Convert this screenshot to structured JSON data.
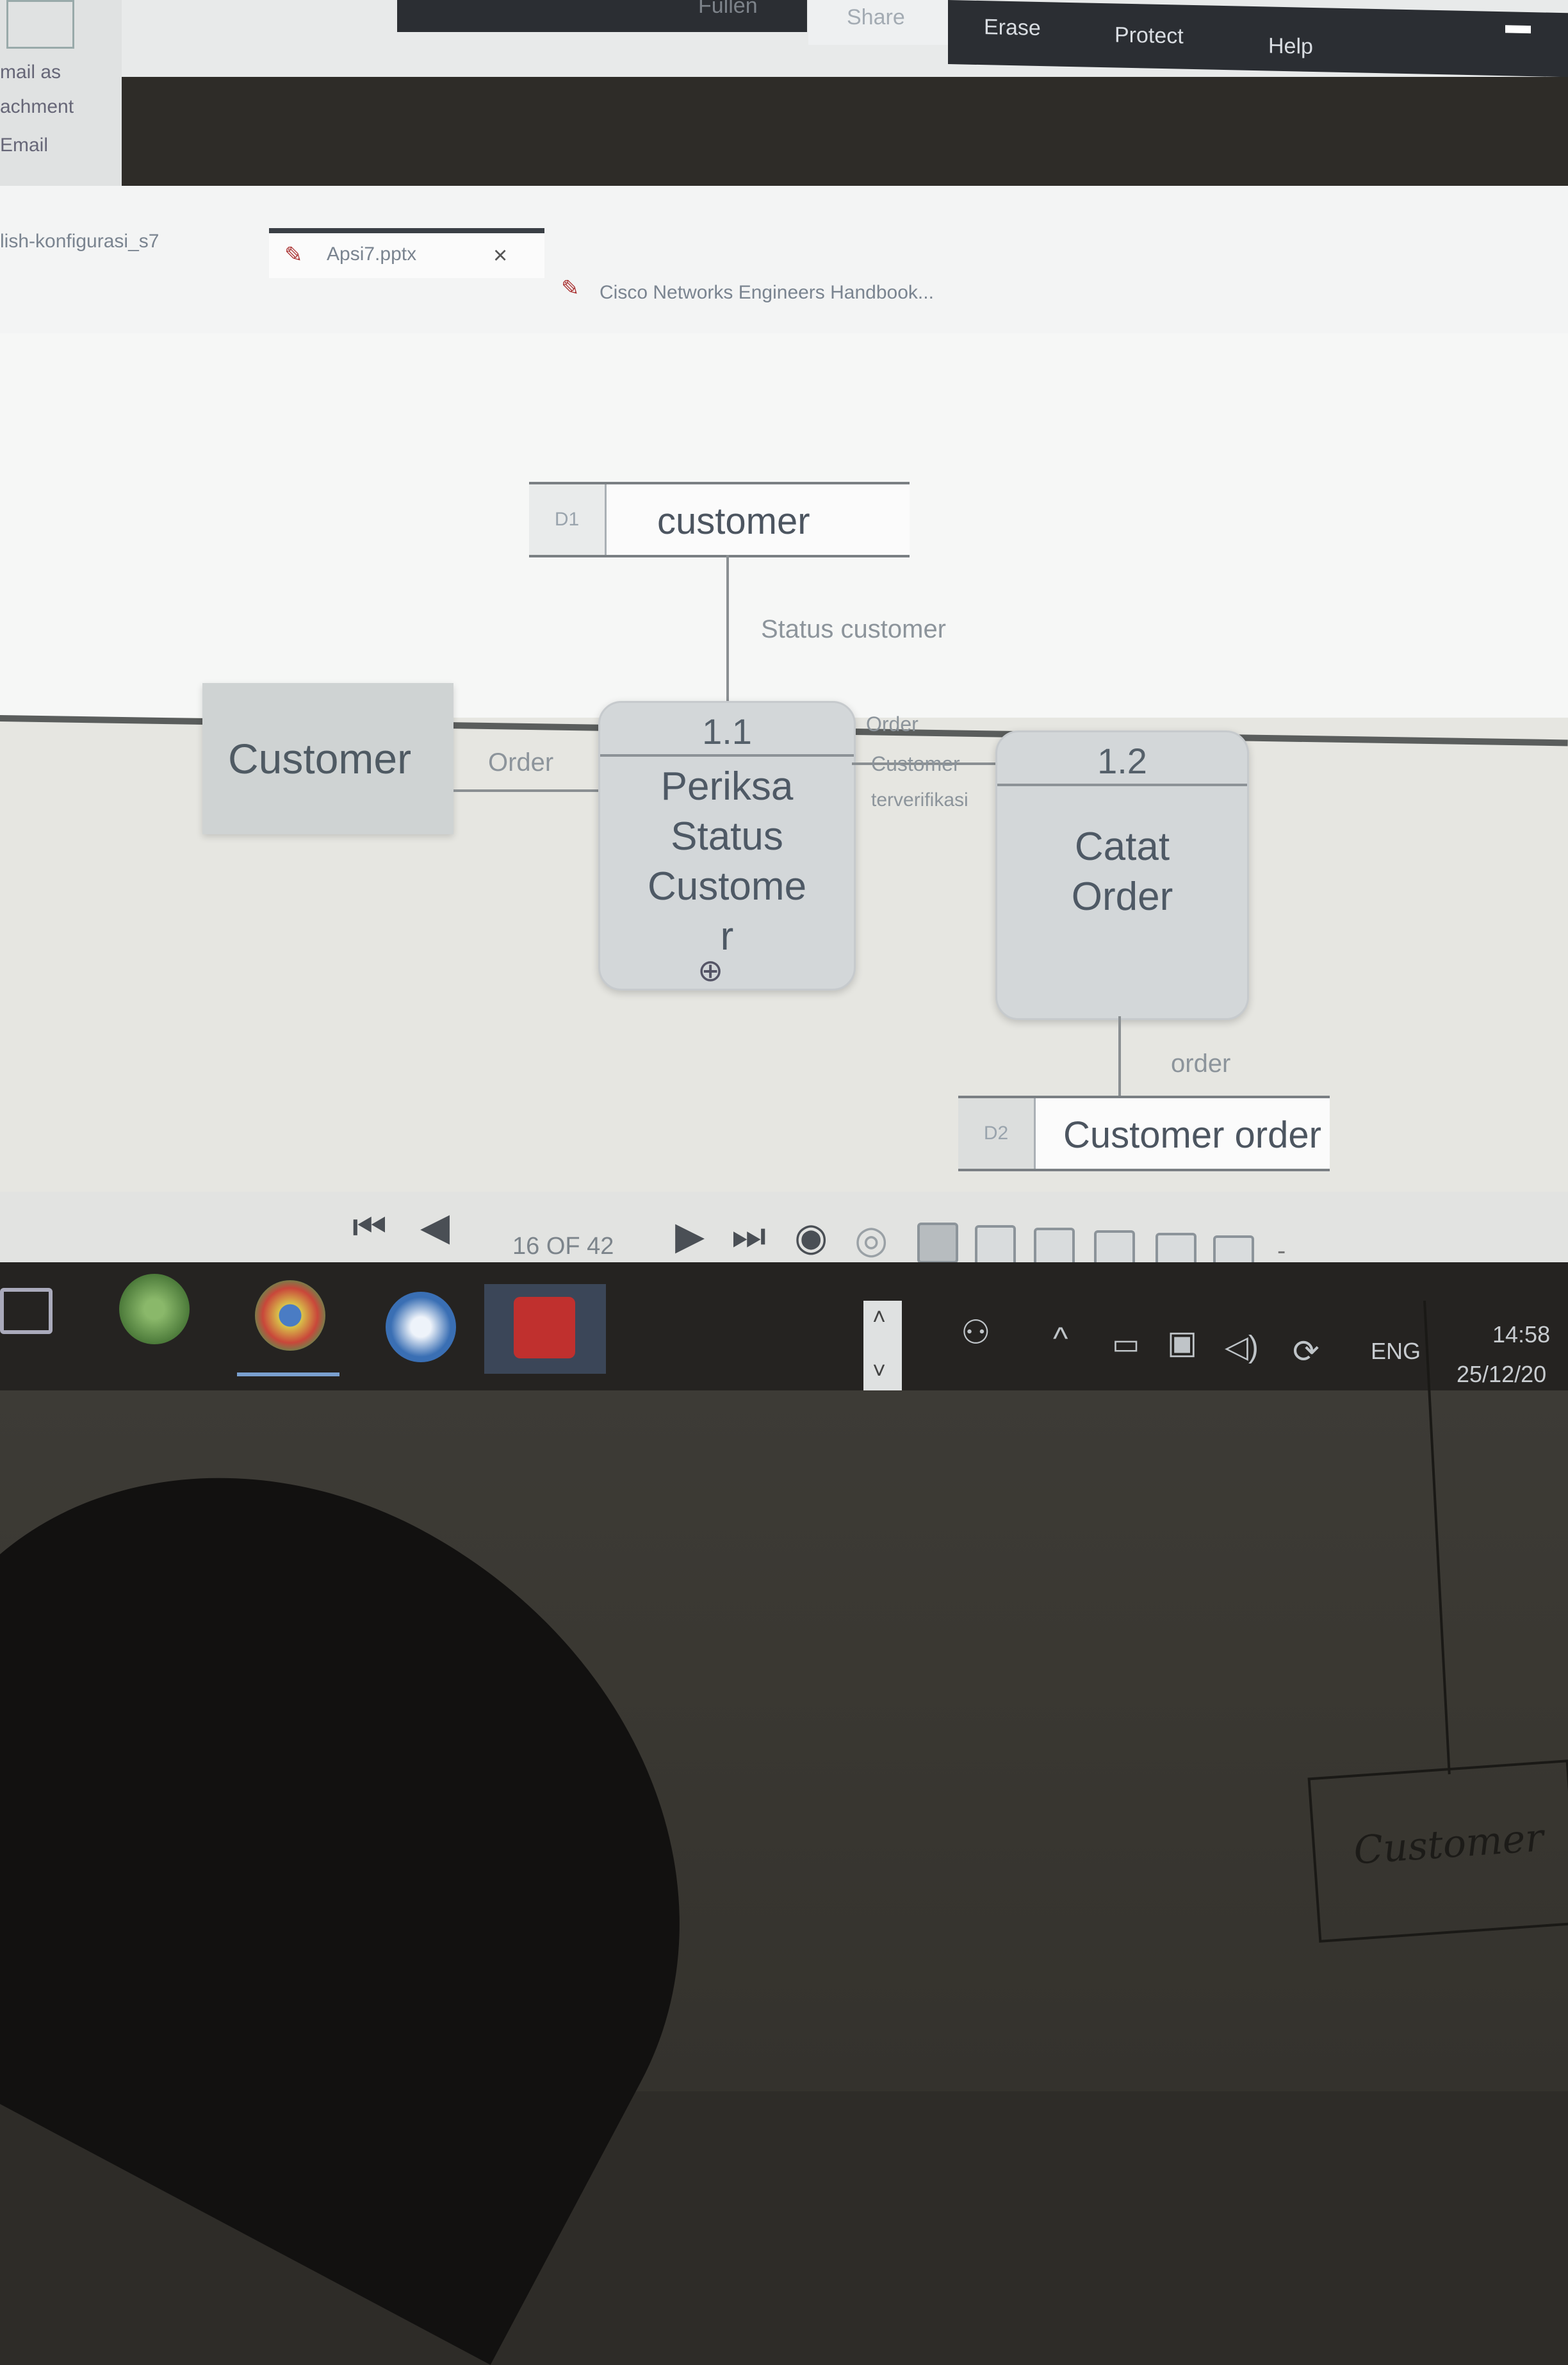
{
  "ribbon": {
    "tabs": [
      "Fullen",
      "Share",
      "Erase",
      "Protect",
      "Help"
    ],
    "left_items": [
      "mail as",
      "achment",
      "Email"
    ]
  },
  "document_tabs": [
    {
      "label": "lish-konfigurasi_s7",
      "active": false
    },
    {
      "label": "Apsi7.pptx",
      "active": true,
      "close": "×"
    },
    {
      "label": "Cisco Networks Engineers Handbook...",
      "active": false
    }
  ],
  "diagram": {
    "stores": [
      {
        "id": "D1",
        "name": "customer"
      },
      {
        "id": "D2",
        "name": "Customer order"
      }
    ],
    "entity": {
      "name": "Customer"
    },
    "processes": [
      {
        "id": "1.1",
        "name_lines": [
          "Periksa",
          "Status",
          "Custome",
          "r"
        ]
      },
      {
        "id": "1.2",
        "name_lines": [
          "Catat",
          "Order"
        ]
      }
    ],
    "flows": {
      "status_customer": "Status customer",
      "order_in": "Order",
      "order_label": "Order",
      "customer": "Customer",
      "terverifikasi": "terverifikasi",
      "order_out": "order"
    }
  },
  "navigation": {
    "counter": "16 OF 42",
    "zoom_marker": "-"
  },
  "taskbar": {
    "language": "ENG",
    "time": "14:58",
    "date": "25/12/20"
  },
  "desk": {
    "sketch_label": "Customer"
  }
}
